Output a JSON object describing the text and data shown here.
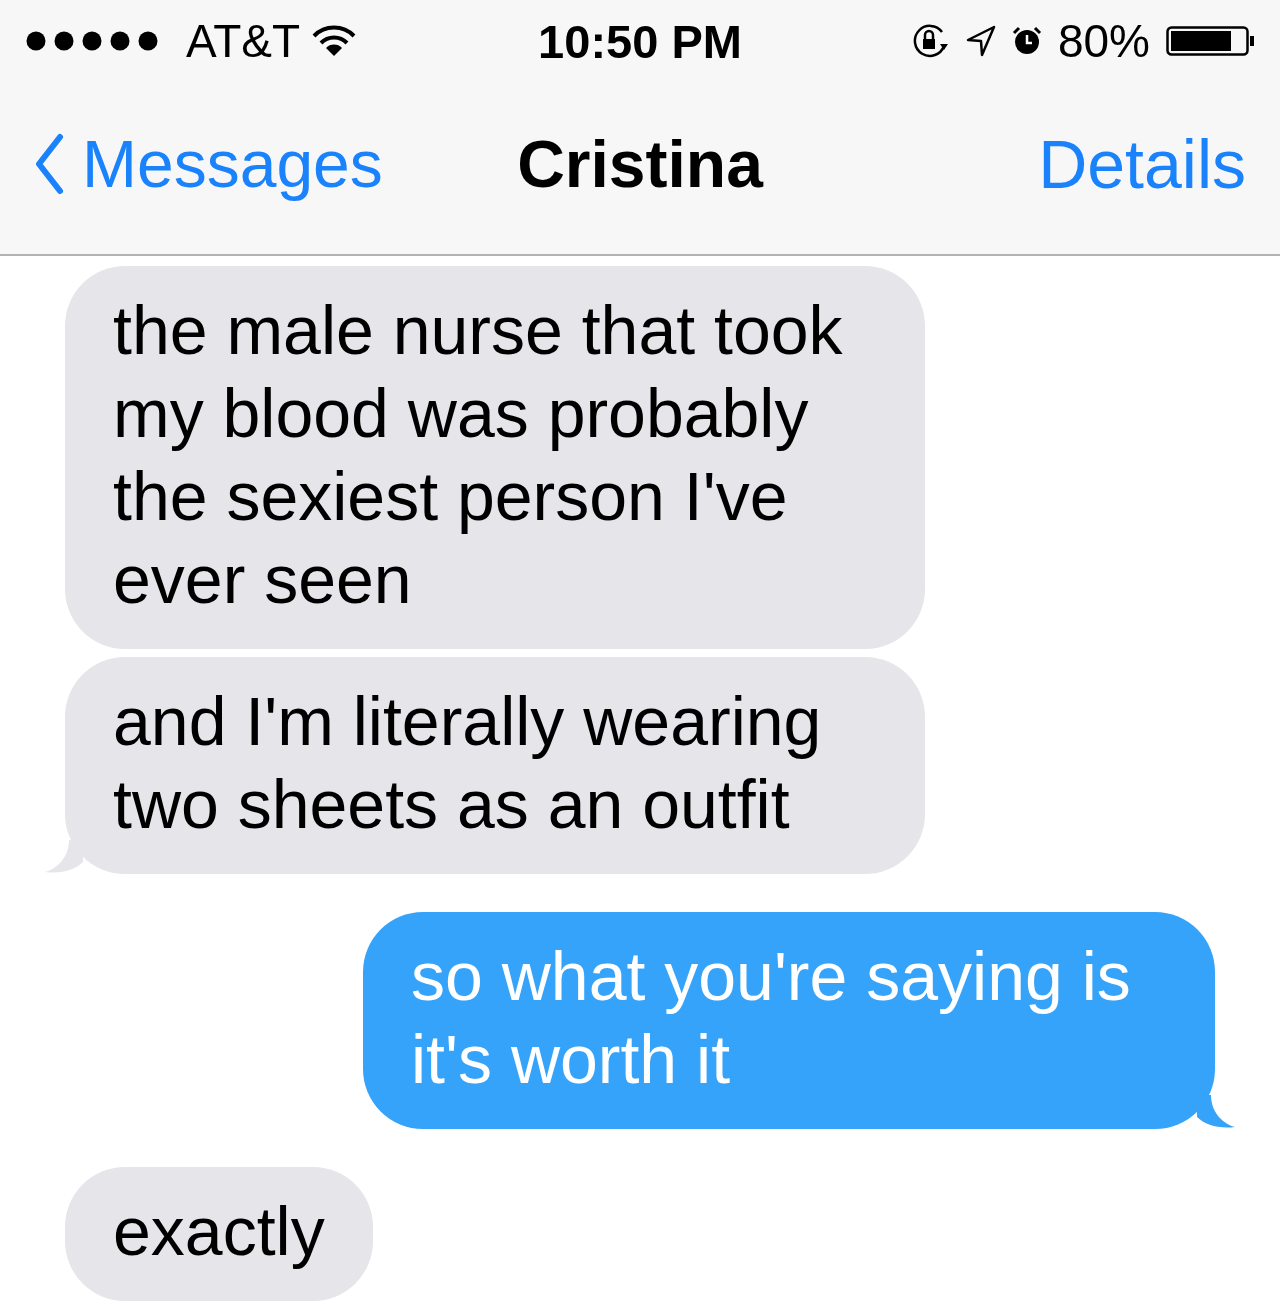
{
  "status_bar": {
    "carrier": "AT&T",
    "time": "10:50 PM",
    "battery": "80%"
  },
  "nav": {
    "back": "Messages",
    "title": "Cristina",
    "action": "Details"
  },
  "messages": [
    {
      "kind": "incoming",
      "text": "the male nurse that took my blood was probably the sexiest person I've ever seen",
      "tail": false
    },
    {
      "kind": "incoming",
      "text": "and I'm literally wearing two sheets as an outfit",
      "tail": true
    },
    {
      "kind": "outgoing",
      "text": "so what you're saying is it's worth it",
      "tail": true
    },
    {
      "kind": "incoming",
      "text": "exactly",
      "tail": false
    }
  ]
}
